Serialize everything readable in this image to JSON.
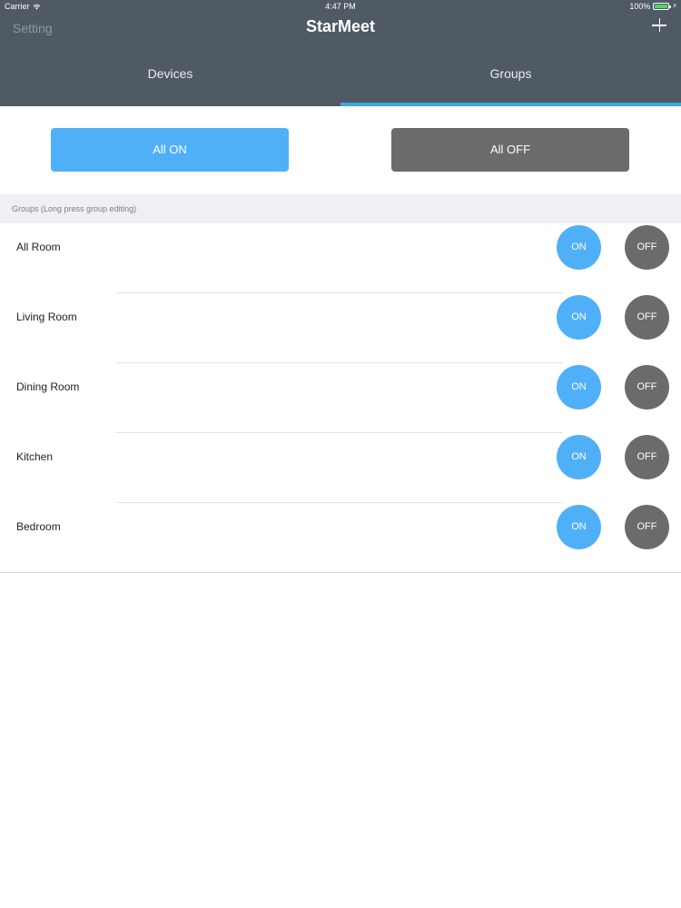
{
  "status_bar": {
    "carrier": "Carrier",
    "time": "4:47 PM",
    "battery": "100%"
  },
  "nav": {
    "left_label": "Setting",
    "title": "StarMeet"
  },
  "tabs": [
    {
      "label": "Devices",
      "active": false
    },
    {
      "label": "Groups",
      "active": true
    }
  ],
  "actions": {
    "all_on_label": "All ON",
    "all_off_label": "All OFF"
  },
  "section": {
    "title": "Groups (Long press group editing)"
  },
  "groups": [
    {
      "name": "All Room",
      "on_label": "ON",
      "off_label": "OFF"
    },
    {
      "name": "Living Room",
      "on_label": "ON",
      "off_label": "OFF"
    },
    {
      "name": "Dining Room",
      "on_label": "ON",
      "off_label": "OFF"
    },
    {
      "name": "Kitchen",
      "on_label": "ON",
      "off_label": "OFF"
    },
    {
      "name": "Bedroom",
      "on_label": "ON",
      "off_label": "OFF"
    }
  ],
  "colors": {
    "header": "#4f5a64",
    "accent": "#3fa6df",
    "on_button": "#4fb0f7",
    "off_button": "#6b6b6b",
    "section_bg": "#efeff4"
  }
}
